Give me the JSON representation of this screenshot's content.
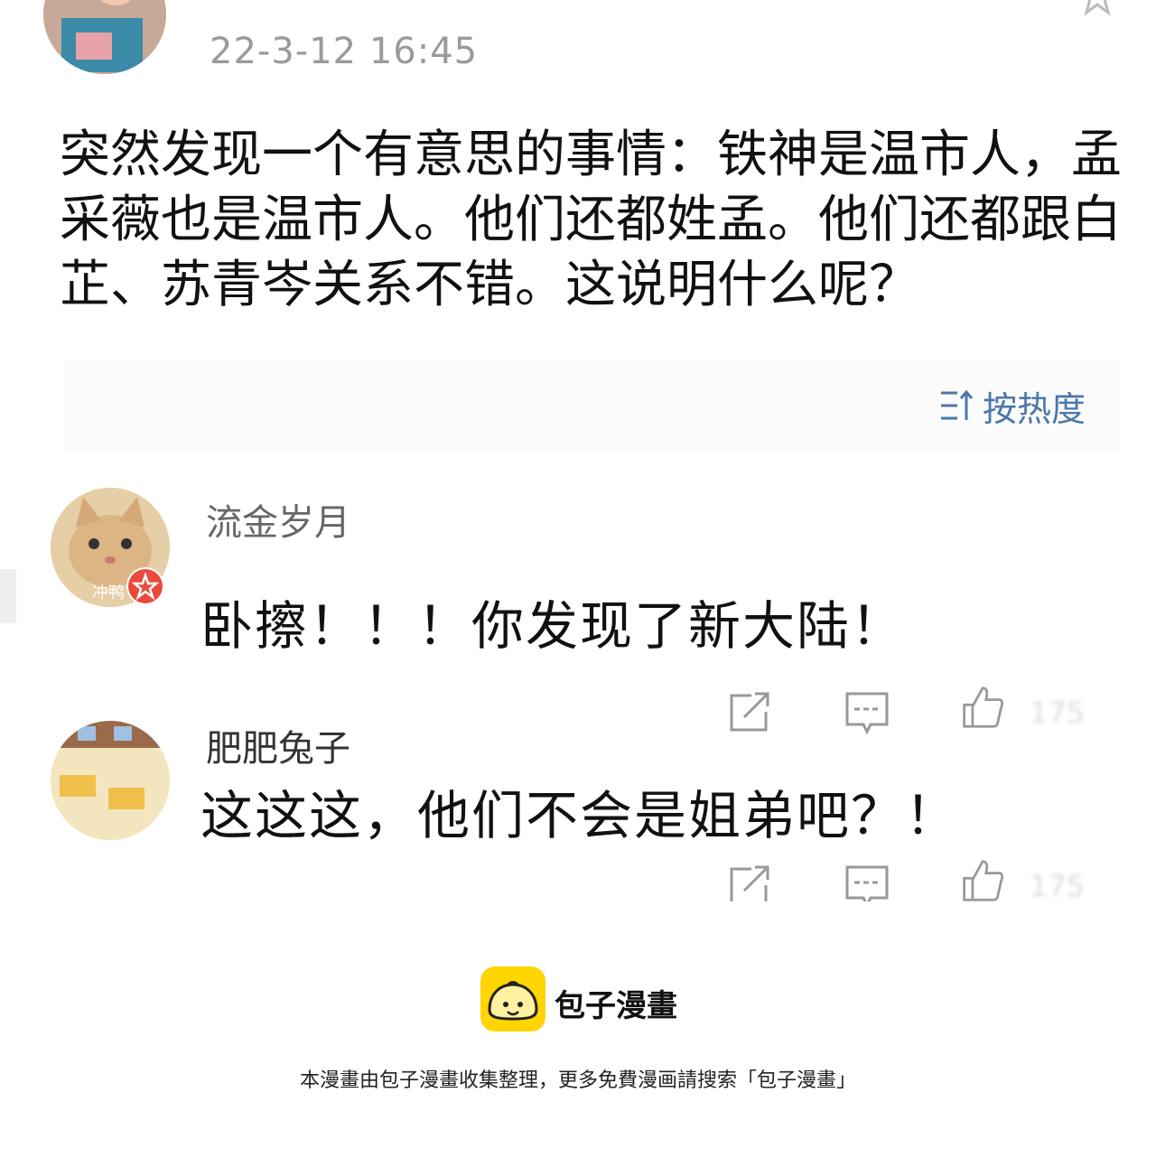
{
  "post": {
    "timestamp": "22-3-12 16:45",
    "body": "突然发现一个有意思的事情：铁神是温市人，孟采薇也是温市人。他们还都姓孟。他们还都跟白芷、苏青岑关系不错。这说明什么呢？",
    "avatar_icon": "user-avatar-icon",
    "favorite_icon": "star-icon"
  },
  "sort": {
    "label": "按热度",
    "icon": "sort-icon"
  },
  "comments": [
    {
      "username": "流金岁月",
      "badge_label": "冲鸭",
      "text": "卧擦！！！你发现了新大陆！",
      "like_count": "175",
      "avatar_icon": "cat-avatar-icon"
    },
    {
      "username": "肥肥兔子",
      "text": "这这这，他们不会是姐弟吧？！",
      "like_count": "175",
      "avatar_icon": "classroom-avatar-icon"
    }
  ],
  "actions": [
    "share-icon",
    "comment-icon",
    "like-icon"
  ],
  "footer": {
    "brand": "包子漫畫",
    "note": "本漫畫由包子漫畫收集整理，更多免費漫画請搜索「包子漫畫」",
    "logo_icon": "bun-logo-icon",
    "logo_color": "#ffd400"
  },
  "colors": {
    "sort_link": "#4a78a8",
    "timestamp": "#9a9a9a",
    "username": "#666666"
  }
}
